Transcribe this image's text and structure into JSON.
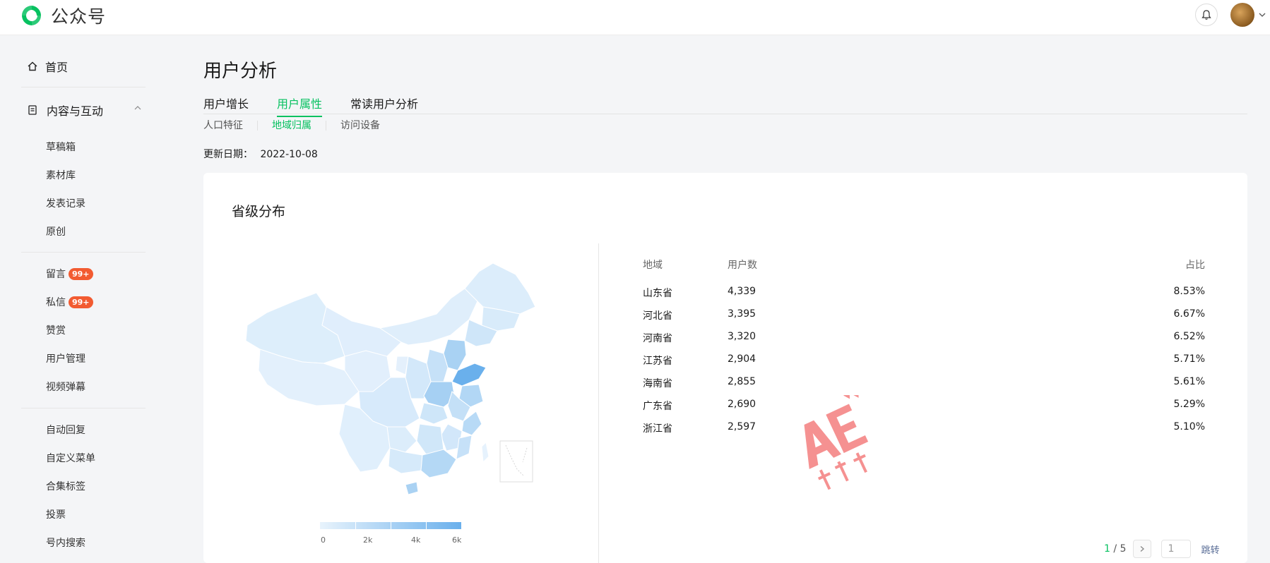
{
  "app": {
    "title": "公众号"
  },
  "sidebar": {
    "home": "首页",
    "group": "内容与互动",
    "items_a": [
      "草稿箱",
      "素材库",
      "发表记录",
      "原创"
    ],
    "items_b": [
      {
        "label": "留言",
        "badge": "99+"
      },
      {
        "label": "私信",
        "badge": "99+"
      },
      {
        "label": "赞赏"
      },
      {
        "label": "用户管理"
      },
      {
        "label": "视频弹幕"
      }
    ],
    "items_c": [
      "自动回复",
      "自定义菜单",
      "合集标签",
      "投票",
      "号内搜索"
    ]
  },
  "page": {
    "title": "用户分析",
    "tabs": [
      "用户增长",
      "用户属性",
      "常读用户分析"
    ],
    "active_tab": "用户属性",
    "subtabs": [
      "人口特征",
      "地域归属",
      "访问设备"
    ],
    "active_subtab": "地域归属",
    "update_label": "更新日期：",
    "update_date": "2022-10-08"
  },
  "card": {
    "title": "省级分布",
    "legend": [
      "0",
      "2k",
      "4k",
      "6k"
    ],
    "columns": [
      "地域",
      "用户数",
      "占比"
    ],
    "rows": [
      {
        "region": "山东省",
        "users": "4,339",
        "pct": "8.53%"
      },
      {
        "region": "河北省",
        "users": "3,395",
        "pct": "6.67%"
      },
      {
        "region": "河南省",
        "users": "3,320",
        "pct": "6.52%"
      },
      {
        "region": "江苏省",
        "users": "2,904",
        "pct": "5.71%"
      },
      {
        "region": "海南省",
        "users": "2,855",
        "pct": "5.61%"
      },
      {
        "region": "广东省",
        "users": "2,690",
        "pct": "5.29%"
      },
      {
        "region": "浙江省",
        "users": "2,597",
        "pct": "5.10%"
      }
    ],
    "pager": {
      "current": "1",
      "sep": " / ",
      "total": "5",
      "input_value": "1",
      "jump": "跳转"
    }
  },
  "watermark": {
    "big": "AE",
    "small": "新媒体"
  },
  "colors": {
    "accent": "#07c160",
    "badge": "#f25b31",
    "map_light": "#e8f3fc",
    "map_dark": "#6ab0ec"
  }
}
